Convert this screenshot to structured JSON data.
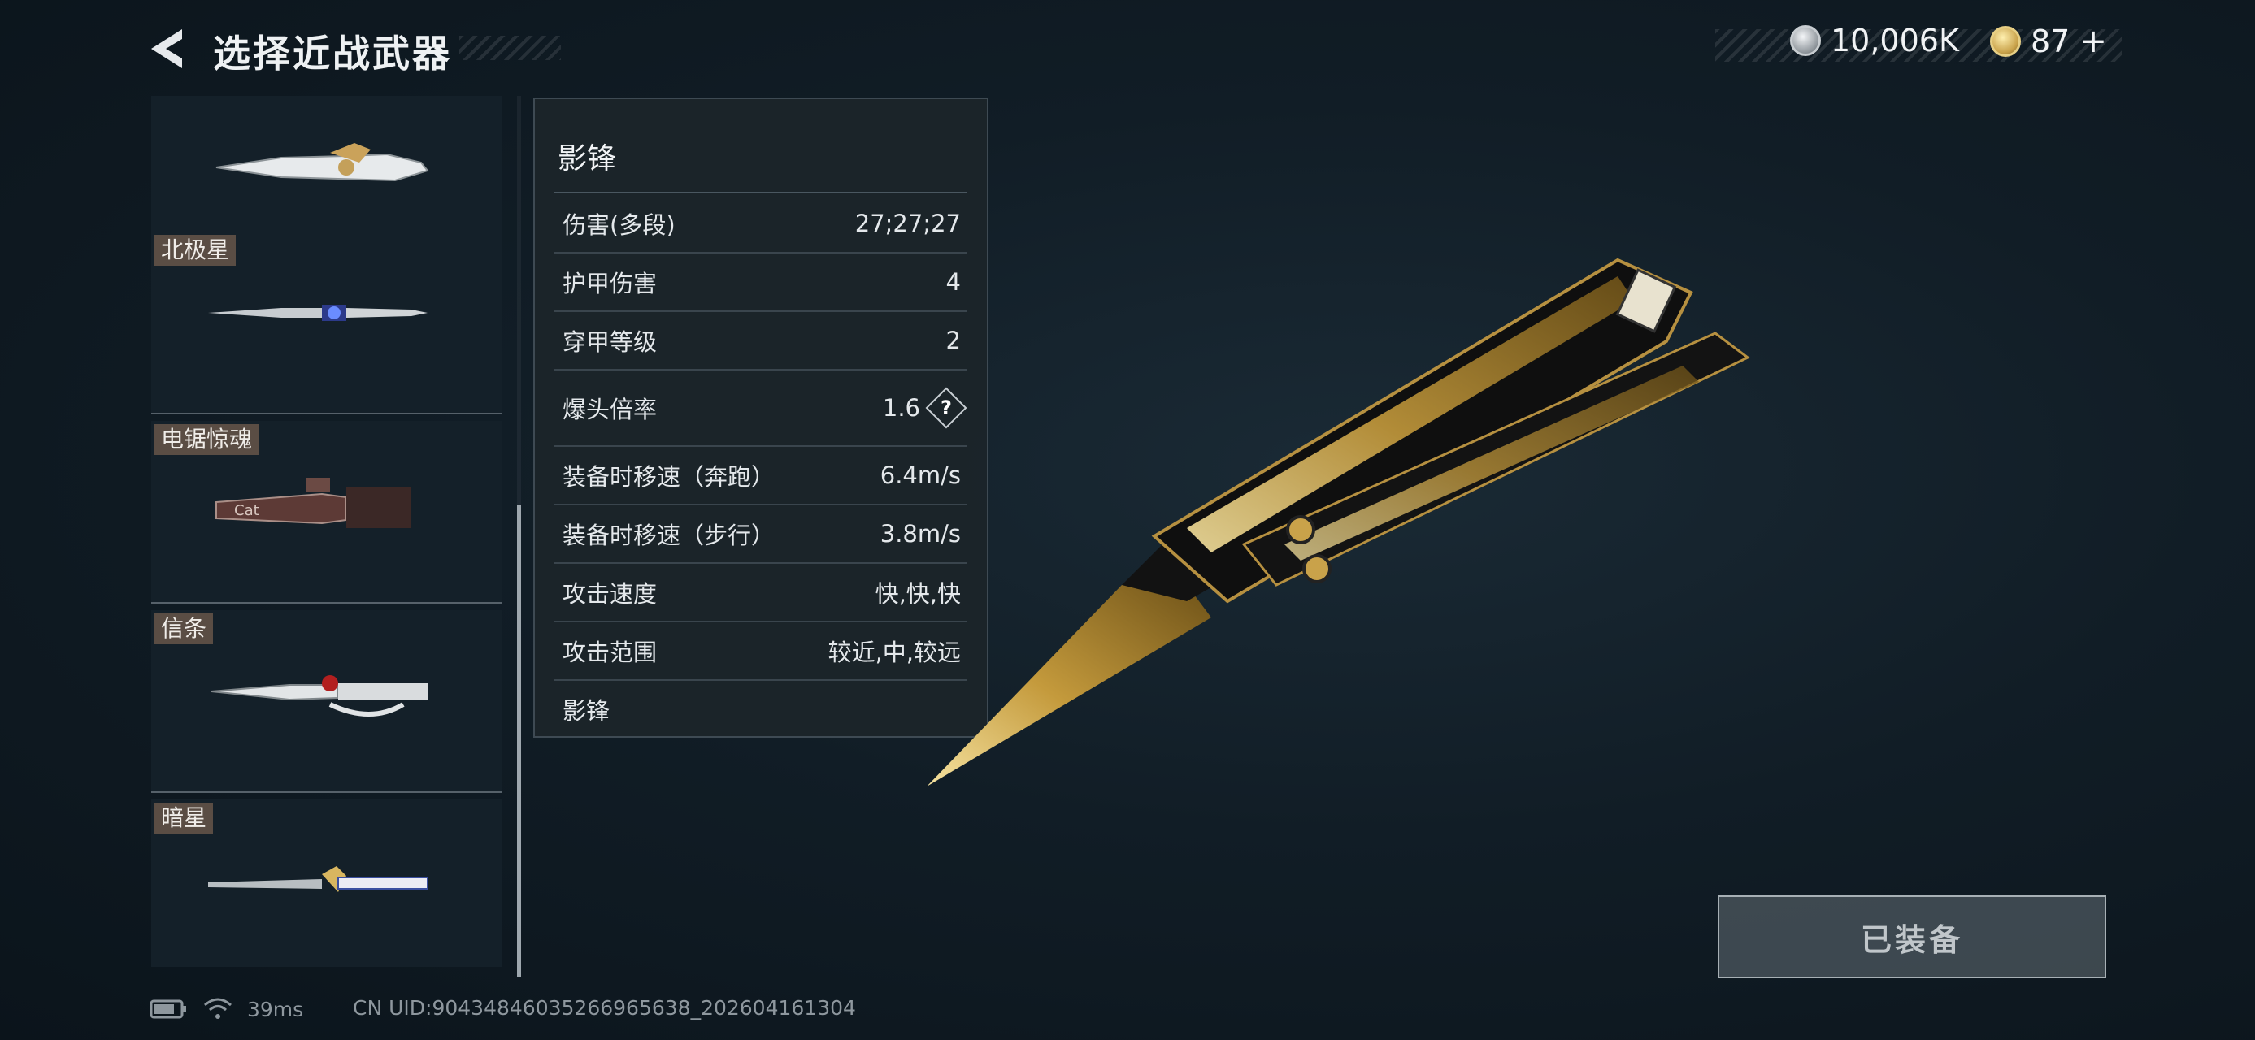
{
  "header": {
    "title": "选择近战武器",
    "currency_silver": "10,006K",
    "currency_gold": "87",
    "add_symbol": "+"
  },
  "weapons": [
    {
      "name": ""
    },
    {
      "name": "北极星"
    },
    {
      "name": "电锯惊魂"
    },
    {
      "name": "信条"
    },
    {
      "name": "暗星"
    }
  ],
  "stats": {
    "title": "影锋",
    "rows": [
      {
        "label": "伤害(多段)",
        "value": "27;27;27"
      },
      {
        "label": "护甲伤害",
        "value": "4"
      },
      {
        "label": "穿甲等级",
        "value": "2"
      },
      {
        "label": "爆头倍率",
        "value": "1.6"
      },
      {
        "label": "装备时移速（奔跑）",
        "value": "6.4m/s"
      },
      {
        "label": "装备时移速（步行）",
        "value": "3.8m/s"
      },
      {
        "label": "攻击速度",
        "value": "快,快,快"
      },
      {
        "label": "攻击范围",
        "value": "较近,中,较远"
      }
    ],
    "footer": "影锋",
    "help_symbol": "?"
  },
  "equip_button": {
    "label": "已装备"
  },
  "status": {
    "ping": "39ms",
    "uid": "CN UID:9043484603526696563​8_202604161304"
  },
  "colors": {
    "name_tag_bg": "#5a4d44",
    "gold": "#c9a24a",
    "panel_bg": "#1c242a"
  }
}
